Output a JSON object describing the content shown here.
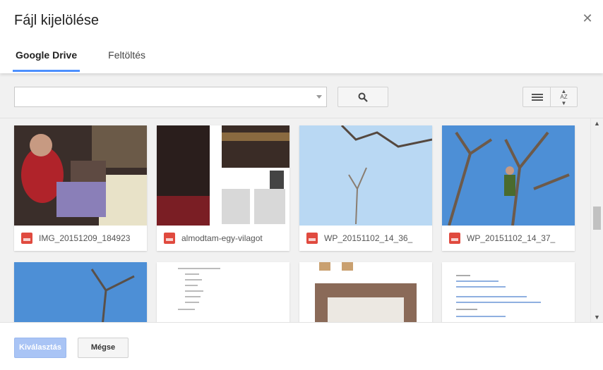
{
  "dialog": {
    "title": "Fájl kijelölése",
    "close_icon": "close-icon",
    "tabs": [
      {
        "label": "Google Drive",
        "active": true
      },
      {
        "label": "Feltöltés",
        "active": false
      }
    ]
  },
  "toolbar": {
    "search_value": "",
    "search_icon": "search-icon",
    "list_view_icon": "list-view-icon",
    "sort_label": "AZ",
    "sort_icon": "sort-az-icon"
  },
  "files": [
    {
      "name": "IMG_20151209_184923",
      "type": "image"
    },
    {
      "name": "almodtam-egy-vilagot",
      "type": "pdf"
    },
    {
      "name": "WP_20151102_14_36_",
      "type": "image"
    },
    {
      "name": "WP_20151102_14_37_",
      "type": "image"
    }
  ],
  "footer": {
    "select_label": "Kiválasztás",
    "cancel_label": "Mégse"
  },
  "colors": {
    "accent_blue": "#4d90fe",
    "file_icon_red": "#e04a3f",
    "disabled_button_blue": "#a9c4f5"
  }
}
